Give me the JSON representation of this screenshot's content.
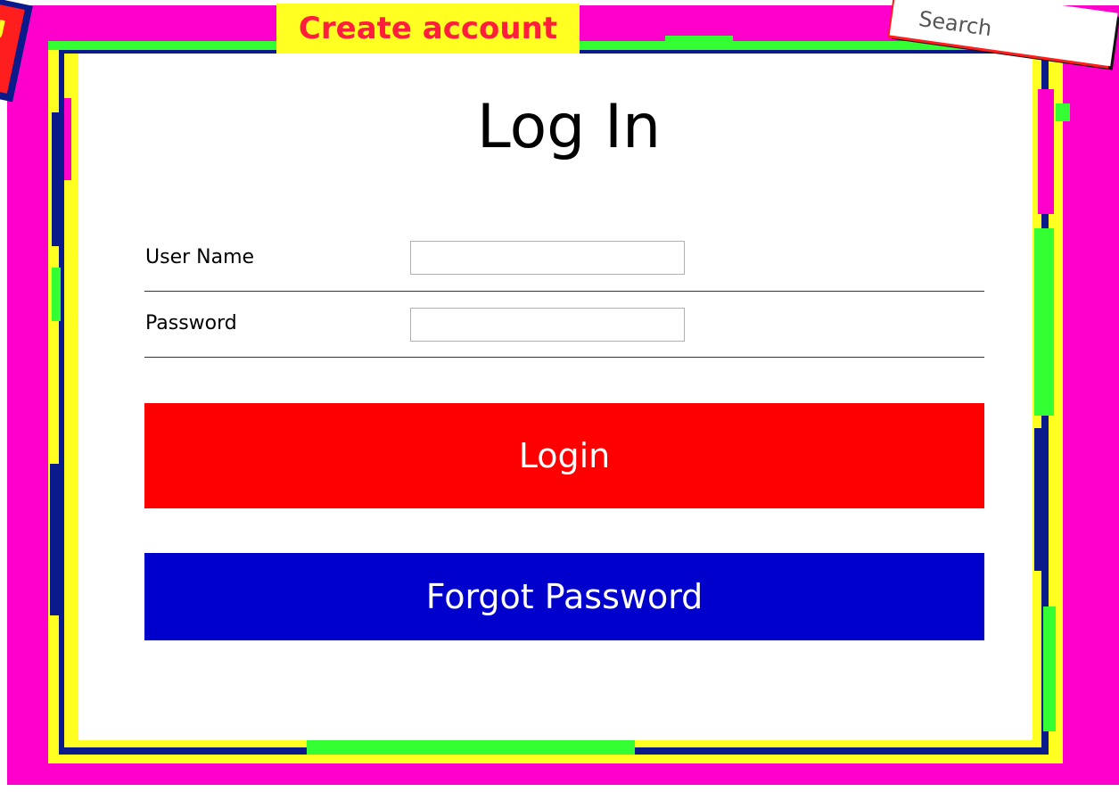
{
  "header": {
    "create_account_label": "Create account",
    "search_placeholder": "Search",
    "corner_badge_text": "g"
  },
  "login_form": {
    "title": "Log In",
    "username_label": "User Name",
    "username_value": "",
    "password_label": "Password",
    "password_value": "",
    "login_button_label": "Login",
    "forgot_password_label": "Forgot Password"
  },
  "colors": {
    "background": "#ff00cc",
    "frame_yellow": "#ffff22",
    "frame_navy": "#0a1a8a",
    "frame_green": "#33ff33",
    "login_button": "#ff0000",
    "forgot_button": "#0000cc",
    "create_account_text": "#ff1e3c"
  }
}
